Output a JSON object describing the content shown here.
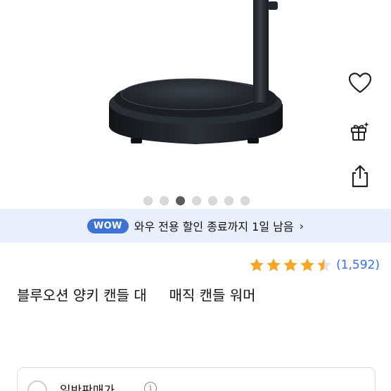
{
  "image_carousel": {
    "total_slides": 7,
    "active_index": 2
  },
  "side_actions": {
    "favorite_icon": "heart-icon",
    "gift_icon": "gift-icon",
    "share_icon": "share-icon"
  },
  "wow_banner": {
    "badge": "WOW",
    "text": "와우 전용 할인 종료까지 1일 남음",
    "chevron": "›",
    "badge_color": "#3f72d6",
    "background": "#e9f0fb"
  },
  "rating": {
    "stars": 4.5,
    "count_text": "(1,592)",
    "star_color": "#f5a623",
    "count_color": "#346aff"
  },
  "product": {
    "title": "블루오션 양키 캔들 대     매직 캔들 워머"
  },
  "price_option": {
    "label": "일반판매가",
    "info_icon": "i"
  }
}
